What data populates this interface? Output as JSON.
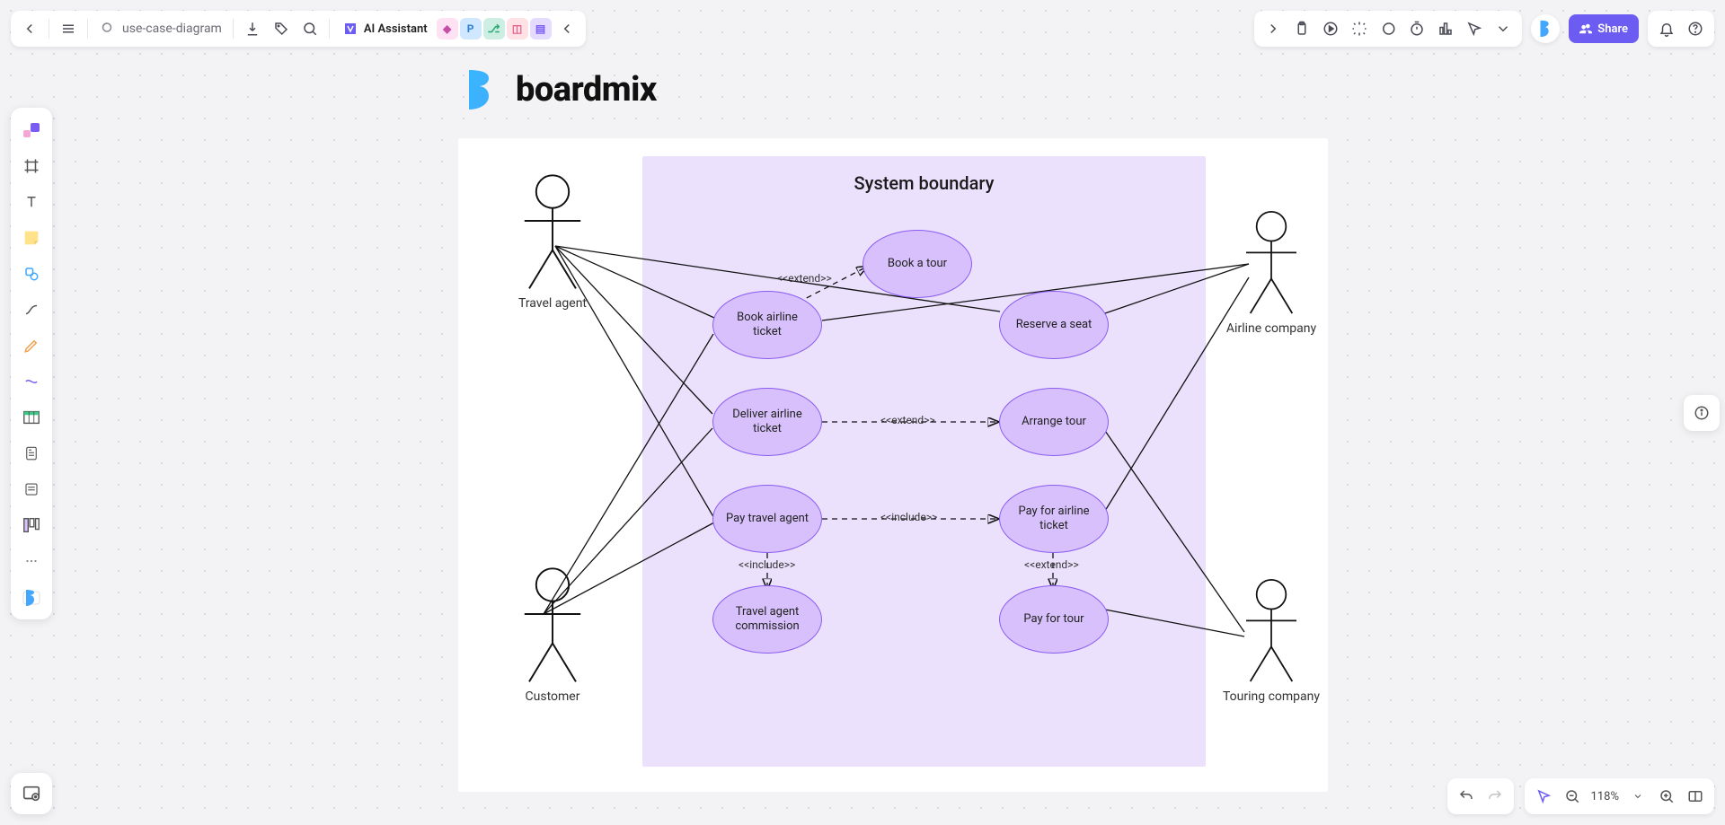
{
  "header": {
    "doc_name": "use-case-diagram",
    "ai_label": "AI Assistant",
    "share": "Share"
  },
  "zoom": {
    "value": "118%"
  },
  "brand": {
    "name": "boardmix"
  },
  "diagram": {
    "boundary_title": "System boundary",
    "actors": {
      "travel_agent": "Travel agent",
      "customer": "Customer",
      "airline_company": "Airline company",
      "touring_company": "Touring company"
    },
    "usecases": {
      "book_tour": "Book a tour",
      "book_airline": "Book airline ticket",
      "reserve_seat": "Reserve a seat",
      "deliver_airline": "Deliver airline ticket",
      "arrange_tour": "Arrange tour",
      "pay_travel_agent": "Pay travel agent",
      "pay_airline": "Pay for airline ticket",
      "travel_agent_commission": "Travel agent commission",
      "pay_for_tour": "Pay for tour"
    },
    "relations": {
      "extend1": "<<extend>>",
      "extend2": "<<extend>>",
      "extend3": "<<extend>>",
      "include1": "<<include>>",
      "include2": "<<include>>"
    }
  }
}
